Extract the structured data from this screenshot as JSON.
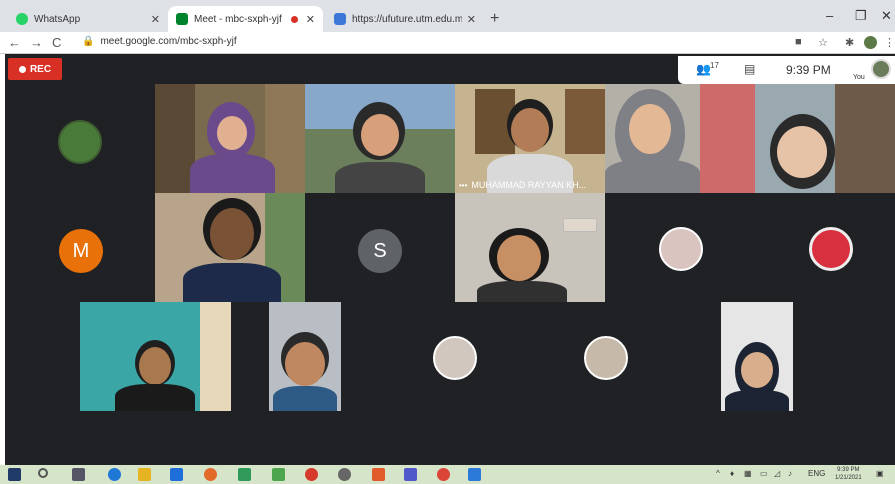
{
  "browser": {
    "tabs": [
      {
        "title": "WhatsApp",
        "active": false
      },
      {
        "title": "Meet - mbc-sxph-yjf",
        "active": true
      },
      {
        "title": "https://ufuture.utm.edu.my/acc",
        "active": false
      }
    ],
    "new_tab_label": "+",
    "window_controls": [
      "–",
      "❐",
      "✕"
    ],
    "url": "meet.google.com/mbc-sxph-yjf"
  },
  "meet": {
    "rec_label": "REC",
    "participant_count": "17",
    "time": "9:39 PM",
    "self_label": "You",
    "tiles": [
      {
        "kind": "avatar",
        "label": ""
      },
      {
        "kind": "video",
        "label": ""
      },
      {
        "kind": "video",
        "label": ""
      },
      {
        "kind": "video",
        "label": "MUHAMMAD RAYYAN KH..."
      },
      {
        "kind": "video",
        "label": ""
      },
      {
        "kind": "video",
        "label": ""
      },
      {
        "kind": "letter",
        "label": "M"
      },
      {
        "kind": "video",
        "label": ""
      },
      {
        "kind": "letter",
        "label": "S"
      },
      {
        "kind": "video",
        "label": ""
      },
      {
        "kind": "avatar",
        "label": ""
      },
      {
        "kind": "avatar",
        "label": ""
      },
      {
        "kind": "video",
        "label": ""
      },
      {
        "kind": "video",
        "label": ""
      },
      {
        "kind": "avatar",
        "label": ""
      },
      {
        "kind": "avatar",
        "label": ""
      },
      {
        "kind": "video",
        "label": ""
      }
    ],
    "colors": {
      "rec": "#d93025",
      "m_avatar": "#e8710a",
      "s_avatar": "#5f6368",
      "background": "#202124"
    }
  },
  "taskbar": {
    "clock_time": "9:39 PM",
    "clock_date": "1/21/2021",
    "lang": "ENG"
  }
}
